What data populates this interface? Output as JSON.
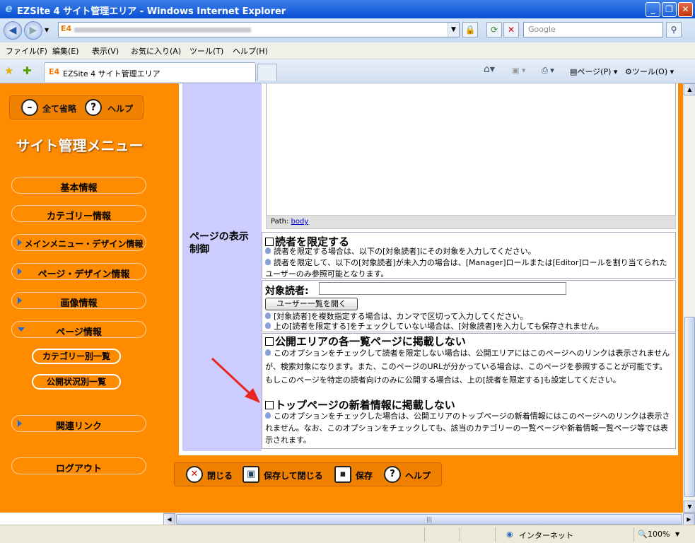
{
  "window": {
    "title": "EZSite 4 サイト管理エリア - Windows Internet Explorer"
  },
  "address": {
    "url_prefix": "E4",
    "search_placeholder": "Google"
  },
  "menubar": [
    "ファイル(F)",
    "編集(E)",
    "表示(V)",
    "お気に入り(A)",
    "ツール(T)",
    "ヘルプ(H)"
  ],
  "tab": {
    "title": "EZSite 4 サイト管理エリア"
  },
  "toolbar": {
    "page_label": "ページ(P)",
    "tools_label": "ツール(O)"
  },
  "sidebar": {
    "collapse_all": "全て省略",
    "help": "ヘルプ",
    "title": "サイト管理メニュー",
    "items": [
      {
        "label": "基本情報"
      },
      {
        "label": "カテゴリー情報"
      },
      {
        "label": "メインメニュー・デザイン情報"
      },
      {
        "label": "ページ・デザイン情報"
      },
      {
        "label": "画像情報"
      },
      {
        "label": "ページ情報"
      }
    ],
    "subitems": [
      {
        "label": "カテゴリー別一覧"
      },
      {
        "label": "公開状況別一覧"
      }
    ],
    "related_links": "関連リンク",
    "logout": "ログアウト"
  },
  "editor": {
    "path_label": "Path:",
    "path_link": "body"
  },
  "page_control": {
    "label_line1": "ページの表示",
    "label_line2": "制御",
    "restrict": {
      "heading": "読者を限定する",
      "note1": "読者を限定する場合は、以下の[対象読者]にその対象を入力してください。",
      "note2": "読者を限定して、以下の[対象読者]が未入力の場合は、[Manager]ロールまたは[Editor]ロールを割り当てられたユーザーのみ参照可能となります。"
    },
    "readers": {
      "label": "対象読者:",
      "value": "",
      "open_button": "ユーザー一覧を開く",
      "note1": "[対象読者]を複数指定する場合は、カンマで区切って入力してください。",
      "note2": "上の[読者を限定する]をチェックしていない場合は、[対象読者]を入力しても保存されません。"
    },
    "hide_lists": {
      "heading": "公開エリアの各一覧ページに掲載しない",
      "note": "このオプションをチェックして読者を限定しない場合は、公開エリアにはこのページへのリンクは表示されませんが、検索対象になります。また、このページのURLが分かっている場合は、このページを参照することが可能です。もしこのページを特定の読者向けのみに公開する場合は、上の[読者を限定する]も設定してください。"
    },
    "hide_news": {
      "heading": "トップページの新着情報に掲載しない",
      "note": "このオプションをチェックした場合は、公開エリアのトップページの新着情報にはこのページへのリンクは表示されません。なお、このオプションをチェックしても、該当のカテゴリーの一覧ページや新着情報一覧ページ等では表示されます。"
    }
  },
  "bottom_buttons": {
    "close": "閉じる",
    "save_close": "保存して閉じる",
    "save": "保存",
    "help": "ヘルプ"
  },
  "status": {
    "zone": "インターネット",
    "zoom": "100%"
  },
  "colors": {
    "sidebar_bg": "#ff8c00",
    "label_bg": "#ccccff",
    "arrow": "#e8251e"
  }
}
